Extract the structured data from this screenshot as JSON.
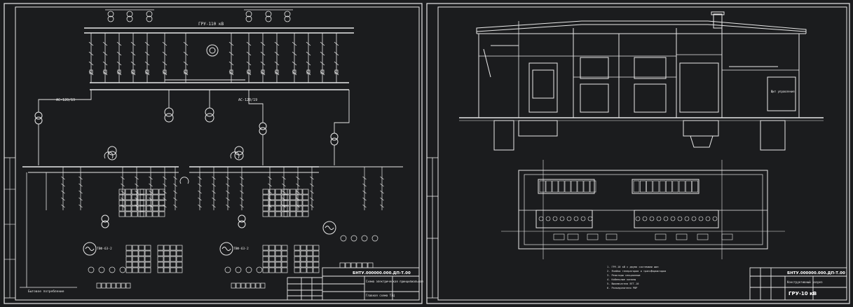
{
  "sheet_left": {
    "bus_label_top": "ГРУ-110 кВ",
    "label_ac": "АС-120/19",
    "label_ac2": "АС-120/19",
    "gen_left": "ТВФ-63-2",
    "gen_right": "ТВФ-63-2",
    "stamp_code": "БНТУ.000000.000.ДП-Т.00",
    "stamp_title": "Схема электрическая принципиальная",
    "stamp_sub": "Главная схема ТЭЦ",
    "bottom_note": "Бытовое потребление"
  },
  "sheet_right": {
    "stamp_code": "БНТУ.000000.000.ДП-Т.00",
    "stamp_title": "ГРУ-10 кВ",
    "stamp_sub": "Конструктивный разрез",
    "room_label": "Щит управления",
    "notes": [
      "1. ГРУ-10 кВ с двумя системами шин",
      "2. Ячейки генераторов и трансформаторов",
      "3. Реакторы секционные",
      "4. Кабельные каналы",
      "5. Выключатели ВГГ-10",
      "6. Разъединители РВР"
    ]
  },
  "colors": {
    "background": "#1b1c1e",
    "line": "#e8e8e8",
    "frame": "#d8d8d8"
  }
}
